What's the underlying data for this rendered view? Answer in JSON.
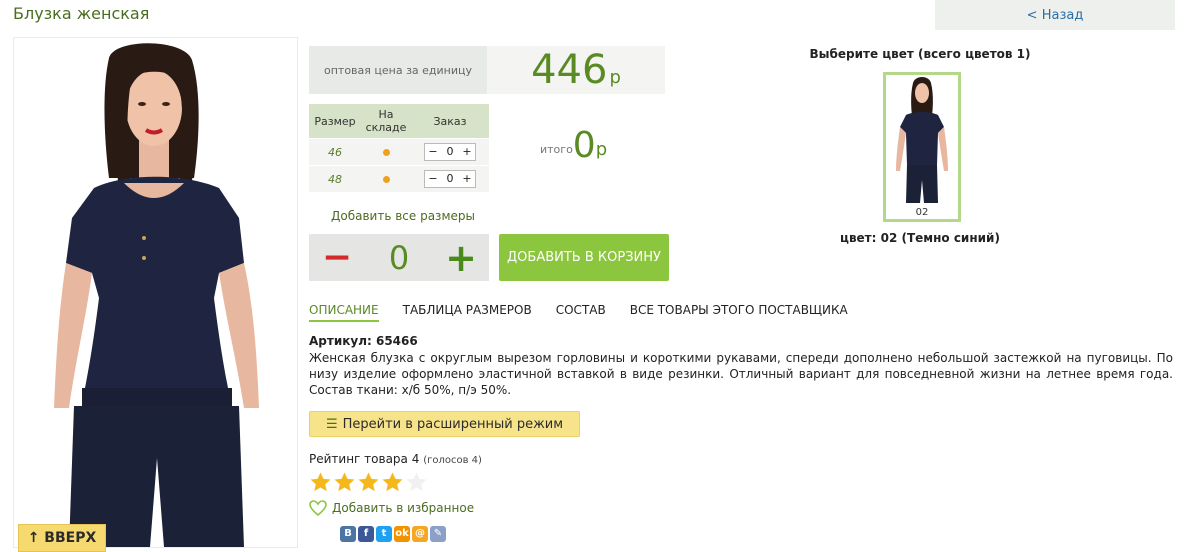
{
  "product": {
    "title": "Блузка женская",
    "back_label": "< Назад",
    "up_label": "↑ ВВЕРХ"
  },
  "price": {
    "label": "оптовая цена за единицу",
    "value": "446",
    "currency": "р"
  },
  "sizes_table": {
    "headers": [
      "Размер",
      "На складе",
      "Заказ"
    ],
    "rows": [
      {
        "size": "46",
        "qty": "0"
      },
      {
        "size": "48",
        "qty": "0"
      }
    ],
    "minus": "−",
    "plus": "+"
  },
  "total": {
    "label": "итого",
    "value": "0",
    "currency": "р"
  },
  "order": {
    "add_all_label": "Добавить все размеры",
    "minus": "−",
    "quantity": "0",
    "plus": "+",
    "cart_button": "ДОБАВИТЬ В КОРЗИНУ"
  },
  "tabs": [
    {
      "label": "ОПИСАНИЕ"
    },
    {
      "label": "ТАБЛИЦА РАЗМЕРОВ"
    },
    {
      "label": "СОСТАВ"
    },
    {
      "label": "ВСЕ ТОВАРЫ ЭТОГО ПОСТАВЩИКА"
    }
  ],
  "article": "Артикул: 65466",
  "description": "Женская блузка с округлым вырезом горловины и короткими рукавами, спереди дополнено небольшой застежкой на пуговицы. По низу изделие оформлено эластичной вставкой в виде резинки. Отличный вариант для повседневной жизни на летнее время года. Состав ткани: х/б 50%, п/э 50%.",
  "extended_mode": "Перейти в расширенный режим",
  "rating": {
    "label": "Рейтинг товара 4",
    "votes": "(голосов 4)",
    "value": 4,
    "max": 5
  },
  "favorite_label": "Добавить в избранное",
  "social": [
    "В",
    "f",
    "t",
    "ok",
    "@",
    "✎"
  ],
  "colors": {
    "title": "Выберите цвет (всего цветов 1)",
    "items": [
      {
        "code": "02"
      }
    ],
    "selected": "цвет: 02 (Темно синий)"
  },
  "theme": {
    "accent_green": "#8cc63f",
    "text_green": "#5a8a24",
    "minus_red": "#d42a2a",
    "star_gold": "#f5b81c"
  }
}
